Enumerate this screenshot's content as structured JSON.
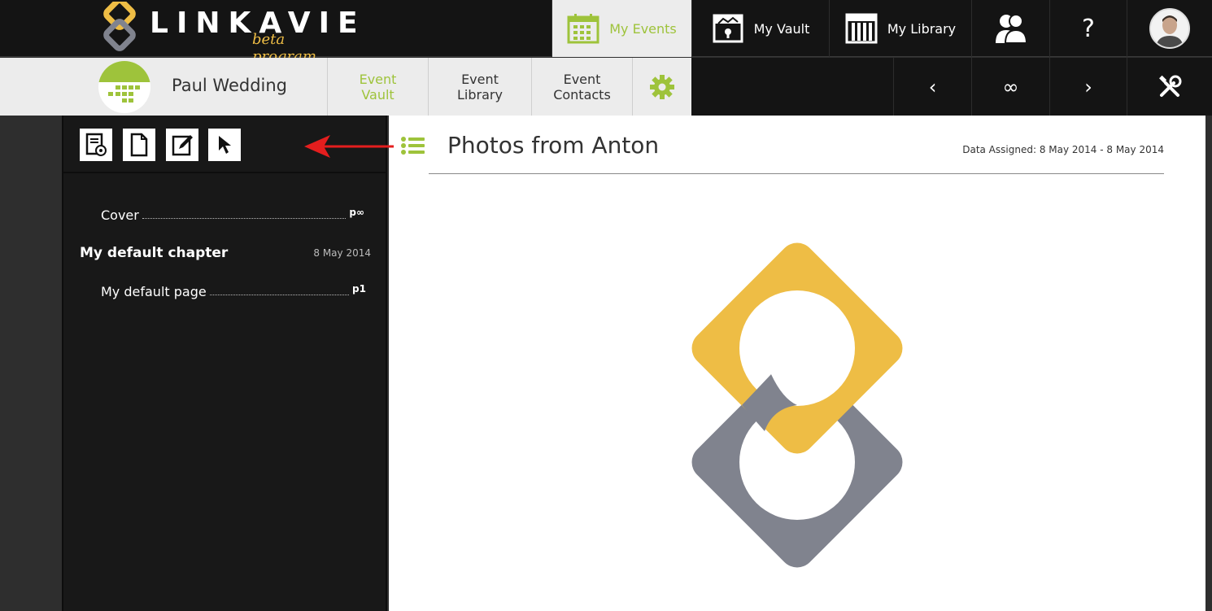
{
  "header": {
    "brand": "LINKAVIE",
    "brand_sub": "beta program",
    "nav": {
      "events": "My Events",
      "vault": "My Vault",
      "library": "My Library",
      "help": "?"
    }
  },
  "event": {
    "title": "Paul Wedding",
    "tabs": {
      "vault": [
        "Event",
        "Vault"
      ],
      "library": [
        "Event",
        "Library"
      ],
      "contacts": [
        "Event",
        "Contacts"
      ]
    }
  },
  "pager": {
    "prev": "‹",
    "all": "∞",
    "next": "›"
  },
  "toc": {
    "cover": {
      "label": "Cover",
      "page": "p∞"
    },
    "chapter": {
      "title": "My default chapter",
      "date": "8 May 2014"
    },
    "page": {
      "label": "My default page",
      "page": "p1"
    }
  },
  "content": {
    "title": "Photos from Anton",
    "data_assigned": "Data Assigned: 8 May 2014 - 8 May 2014"
  },
  "colors": {
    "accent_green": "#9ec33b",
    "logo_yellow": "#eebd45",
    "logo_gray": "#80838e",
    "arrow_red": "#e41e1e"
  },
  "icons": [
    "calendar-icon",
    "vault-icon",
    "library-icon",
    "contacts-icon",
    "help-icon",
    "settings-gear-icon",
    "tools-icon",
    "list-icon",
    "new-chapter-icon",
    "new-page-icon",
    "edit-icon",
    "pointer-icon"
  ]
}
